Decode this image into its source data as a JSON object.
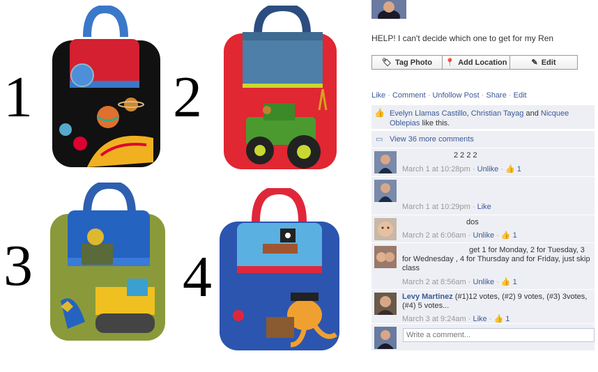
{
  "photo": {
    "labels": [
      "1",
      "2",
      "3",
      "4"
    ]
  },
  "post": {
    "text": "HELP! I can't decide which one to get for my Ren",
    "buttons": {
      "tag_photo": "Tag Photo",
      "add_location": "Add Location",
      "edit": "Edit"
    },
    "actions": {
      "like": "Like",
      "comment": "Comment",
      "unfollow": "Unfollow Post",
      "share": "Share",
      "edit": "Edit"
    },
    "likes": {
      "names": [
        "Evelyn Llamas Castillo",
        "Christian Tayag",
        "Nicquee Oblepias"
      ],
      "and_text": "and",
      "suffix": "like this."
    },
    "view_more": "View 36 more comments"
  },
  "comments": [
    {
      "author": "",
      "text": "2 2 2 2",
      "time": "March 1 at 10:28pm",
      "action": "Unlike",
      "like_count": "1"
    },
    {
      "author": "",
      "text": "",
      "time": "March 1 at 10:29pm",
      "action": "Like",
      "like_count": ""
    },
    {
      "author": "",
      "text": "dos",
      "time": "March 2 at 6:06am",
      "action": "Unlike",
      "like_count": "1"
    },
    {
      "author": "",
      "text": "get 1 for Monday, 2 for Tuesday, 3 for Wednesday , 4 for Thursday and for Friday, just skip class",
      "time": "March 2 at 8:56am",
      "action": "Unlike",
      "like_count": "1"
    },
    {
      "author": "Levy Martinez",
      "text": "(#1)12 votes, (#2) 9 votes, (#3) 3votes, (#4) 5 votes...",
      "time": "March 3 at 9:24am",
      "action": "Like",
      "like_count": "1"
    }
  ],
  "composer": {
    "placeholder": "Write a comment..."
  },
  "colors": {
    "link": "#3b5998",
    "comment_bg": "#edeff4",
    "muted": "#999999"
  }
}
